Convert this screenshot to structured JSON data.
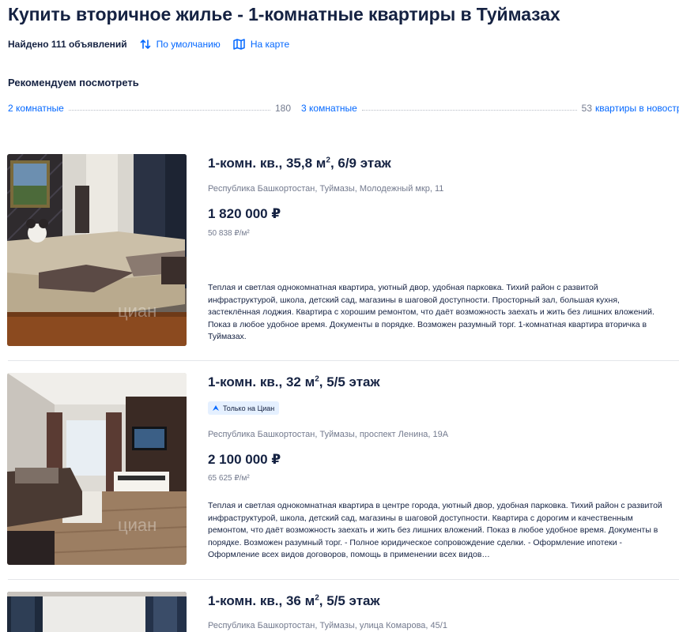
{
  "page": {
    "title": "Купить вторичное жилье - 1-комнатные квартиры в Туймазах"
  },
  "meta": {
    "found": "Найдено 111 объявлений",
    "sort_label": "По умолчанию",
    "map_label": "На карте"
  },
  "recommend": {
    "title": "Рекомендуем посмотреть",
    "items": [
      {
        "label": "2 комнатные",
        "count": "180"
      },
      {
        "label": "3 комнатные",
        "count": "53"
      },
      {
        "label": "квартиры в новостр",
        "count": ""
      }
    ]
  },
  "listings": [
    {
      "title_main": "1-комн. кв., 35,8 м",
      "title_sup": "2",
      "title_tail": ", 6/9 этаж",
      "badge": "",
      "address": "Республика Башкортостан, Туймазы, Молодежный мкр, 11",
      "price": "1 820 000 ₽",
      "price_per_m": "50 838 ₽/м²",
      "description": "Теплая и светлая однокомнатная квартира, уютный двор, удобная парковка. Тихий район с развитой инфраструктурой, школа, детский сад, магазины в шаговой доступности. Просторный зал, большая кухня, застеклённая лоджия. Квартира с хорошим ремонтом, что даёт возможность заехать и жить без лишних вложений. Показ в любое удобное время. Документы в порядке. Возможен разумный торг. 1-комнатная квартира вторичка в Туймазах.",
      "photo_watermark": "циан"
    },
    {
      "title_main": "1-комн. кв., 32 м",
      "title_sup": "2",
      "title_tail": ", 5/5 этаж",
      "badge": "Только на Циан",
      "address": "Республика Башкортостан, Туймазы, проспект Ленина, 19А",
      "price": "2 100 000 ₽",
      "price_per_m": "65 625 ₽/м²",
      "description": "Теплая и светлая однокомнатная квартира в центре города, уютный двор, удобная парковка. Тихий район с развитой инфраструктурой, школа, детский сад, магазины в шаговой доступности. Квартира с дорогим и качественным ремонтом, что даёт возможность заехать и жить без лишних вложений. Показ в любое удобное время. Документы в порядке. Возможен разумный торг. - Полное юридическое сопровождение сделки. - Оформление ипотеки - Оформление всех видов договоров, помощь в применении всех видов…",
      "photo_watermark": "циан"
    },
    {
      "title_main": "1-комн. кв., 36 м",
      "title_sup": "2",
      "title_tail": ", 5/5 этаж",
      "badge": "",
      "address": "Республика Башкортостан, Туймазы, улица Комарова, 45/1",
      "price": "",
      "price_per_m": "",
      "description": "",
      "photo_watermark": ""
    }
  ],
  "colors": {
    "accent": "#0468ff",
    "text": "#152242",
    "secondary": "#737a8e",
    "badge_bg": "#e5f0ff"
  }
}
